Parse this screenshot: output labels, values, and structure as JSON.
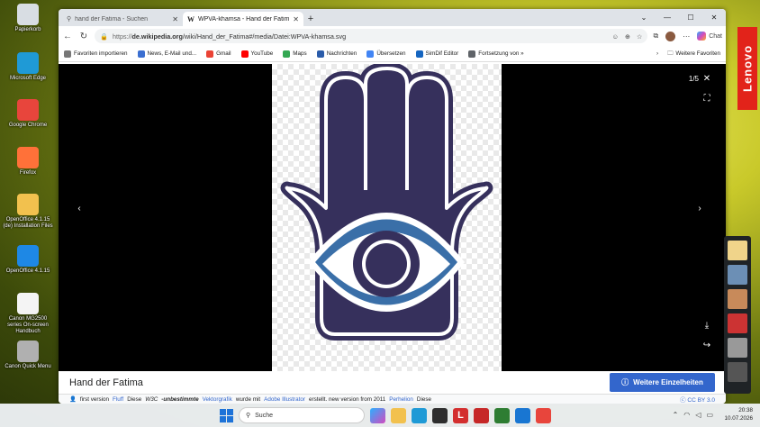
{
  "desktop": {
    "icons": [
      {
        "label": "Papierkorb",
        "icon": "recycle-bin-icon",
        "color": "#d8dde3"
      },
      {
        "label": "Microsoft Edge",
        "icon": "edge-icon",
        "color": "#1f9ad6"
      },
      {
        "label": "Google Chrome",
        "icon": "chrome-icon",
        "color": "#e8453c"
      },
      {
        "label": "Firefox",
        "icon": "firefox-icon",
        "color": "#ff7139"
      },
      {
        "label": "OpenOffice 4.1.15 (de) Installation Files",
        "icon": "folder-icon",
        "color": "#f2c14e"
      },
      {
        "label": "OpenOffice 4.1.15",
        "icon": "openoffice-icon",
        "color": "#1e88e5"
      },
      {
        "label": "Canon MG2500 series On-screen Handbuch",
        "icon": "help-document-icon",
        "color": "#f4f4f4"
      },
      {
        "label": "Canon Quick Menu",
        "icon": "canon-quick-menu-icon",
        "color": "#b0b0b0"
      }
    ],
    "lenovo_label": "Lenovo"
  },
  "browser": {
    "tabs": [
      {
        "title": "hand der Fatima - Suchen",
        "active": false
      },
      {
        "title": "WPVA-khamsa - Hand der Fatima",
        "active": true
      }
    ],
    "url_prefix": "https://",
    "url_host": "de.wikipedia.org",
    "url_path": "/wiki/Hand_der_Fatima#/media/Datei:WPVA-khamsa.svg",
    "chat_label": "Chat",
    "favorites": [
      {
        "label": "Favoriten importieren",
        "color": "#777777"
      },
      {
        "label": "News, E-Mail und...",
        "color": "#3b6fd1"
      },
      {
        "label": "Gmail",
        "color": "#ea4335"
      },
      {
        "label": "YouTube",
        "color": "#ff0000"
      },
      {
        "label": "Maps",
        "color": "#34a853"
      },
      {
        "label": "Nachrichten",
        "color": "#2a5caa"
      },
      {
        "label": "Übersetzen",
        "color": "#4285f4"
      },
      {
        "label": "SimDif Editor",
        "color": "#1565c0"
      },
      {
        "label": "Fortsetzung von »",
        "color": "#5f6368"
      }
    ],
    "other_favorites": "Weitere Favoriten"
  },
  "viewer": {
    "counter": "1/5",
    "caption": "Hand der Fatima",
    "more_button": "Weitere Einzelheiten",
    "info": {
      "t1": "first version",
      "l1": "Fluff",
      "t2": "Diese",
      "t3": "W3C",
      "t4": "-unbestimmte",
      "l2": "Vektorgrafik",
      "t5": "wurde mit",
      "l3": "Adobe Illustrator",
      "t6": "erstellt. new version from 2011",
      "l4": "Perhelion",
      "t7": "Diese"
    },
    "license": "CC BY 3.0",
    "colors": {
      "hand": "#36305c",
      "iris": "#3a6fa8",
      "bg": "#000000",
      "accent": "#3366cc"
    }
  },
  "taskbar": {
    "search_label": "Suche",
    "time": "20:38",
    "date": "10.07.2026"
  }
}
